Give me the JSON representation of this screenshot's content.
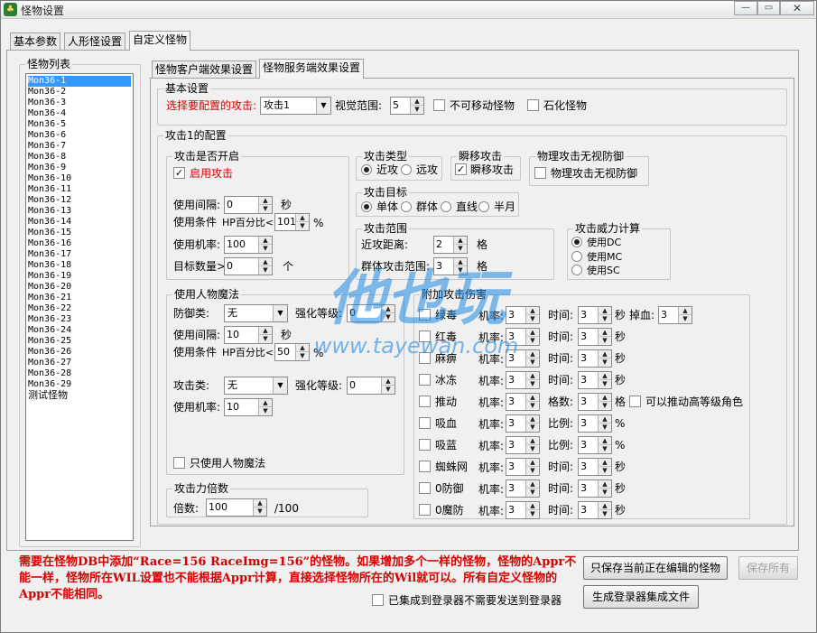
{
  "window": {
    "title": "怪物设置"
  },
  "main_tabs": [
    "基本参数",
    "人形怪设置",
    "自定义怪物"
  ],
  "monster_list": {
    "title": "怪物列表",
    "items": [
      "Mon36-1",
      "Mon36-2",
      "Mon36-3",
      "Mon36-4",
      "Mon36-5",
      "Mon36-6",
      "Mon36-7",
      "Mon36-8",
      "Mon36-9",
      "Mon36-10",
      "Mon36-11",
      "Mon36-12",
      "Mon36-13",
      "Mon36-14",
      "Mon36-15",
      "Mon36-16",
      "Mon36-17",
      "Mon36-18",
      "Mon36-19",
      "Mon36-20",
      "Mon36-21",
      "Mon36-22",
      "Mon36-23",
      "Mon36-24",
      "Mon36-25",
      "Mon36-26",
      "Mon36-27",
      "Mon36-28",
      "Mon36-29",
      "测试怪物"
    ]
  },
  "sub_tabs": [
    "怪物客户端效果设置",
    "怪物服务端效果设置"
  ],
  "basic": {
    "title": "基本设置",
    "select_attack_label": "选择要配置的攻击:",
    "attack_value": "攻击1",
    "view_range_label": "视觉范围:",
    "view_range_value": "5",
    "immovable_label": "不可移动怪物",
    "petrify_label": "石化怪物"
  },
  "config": {
    "title": "攻击1的配置",
    "enable_group": {
      "title": "攻击是否开启",
      "enable_label": "启用攻击",
      "interval_label": "使用间隔:",
      "interval_value": "0",
      "interval_unit": "秒",
      "cond_label": "使用条件",
      "hp_label": "HP百分比<",
      "hp_value": "101",
      "hp_unit": "%",
      "rate_label": "使用机率:",
      "rate_value": "100",
      "target_label": "目标数量>",
      "target_value": "0",
      "target_unit": "个"
    },
    "attack_type": {
      "title": "攻击类型",
      "opt1": "近攻",
      "opt2": "远攻"
    },
    "teleport": {
      "title": "瞬移攻击",
      "label": "瞬移攻击"
    },
    "phys_ignore": {
      "title": "物理攻击无视防御",
      "label": "物理攻击无视防御"
    },
    "target": {
      "title": "攻击目标",
      "opt1": "单体",
      "opt2": "群体",
      "opt3": "直线",
      "opt4": "半月"
    },
    "range": {
      "title": "攻击范围",
      "melee_label": "近攻距离:",
      "melee_value": "2",
      "group_label": "群体攻击范围:",
      "group_value": "3",
      "unit": "格"
    },
    "power": {
      "title": "攻击威力计算",
      "opt1": "使用DC",
      "opt2": "使用MC",
      "opt3": "使用SC"
    },
    "human_magic": {
      "title": "使用人物魔法",
      "defense_label": "防御类:",
      "defense_value": "无",
      "enhance_label": "强化等级:",
      "enhance_value": "0",
      "interval_label": "使用间隔:",
      "interval_value": "10",
      "interval_unit": "秒",
      "cond_label": "使用条件",
      "hp_label": "HP百分比<",
      "hp_value": "50",
      "hp_unit": "%",
      "attack_label": "攻击类:",
      "attack_value": "无",
      "enhance2_label": "强化等级:",
      "enhance2_value": "0",
      "rate_label": "使用机率:",
      "rate_value": "10",
      "only_label": "只使用人物魔法"
    },
    "multiplier": {
      "title": "攻击力倍数",
      "label": "倍数:",
      "value": "100",
      "unit": "/100"
    },
    "extra": {
      "title": "附加攻击伤害",
      "rate_label": "机率:",
      "rows": [
        {
          "name": "绿毒",
          "rate": "3",
          "p_label": "时间:",
          "p_value": "3",
          "p_unit": "秒",
          "extra_label": "掉血:",
          "extra_value": "3"
        },
        {
          "name": "红毒",
          "rate": "3",
          "p_label": "时间:",
          "p_value": "3",
          "p_unit": "秒"
        },
        {
          "name": "麻痹",
          "rate": "3",
          "p_label": "时间:",
          "p_value": "3",
          "p_unit": "秒"
        },
        {
          "name": "冰冻",
          "rate": "3",
          "p_label": "时间:",
          "p_value": "3",
          "p_unit": "秒"
        },
        {
          "name": "推动",
          "rate": "3",
          "p_label": "格数:",
          "p_value": "3",
          "p_unit": "格",
          "check_label": "可以推动高等级角色"
        },
        {
          "name": "吸血",
          "rate": "3",
          "p_label": "比例:",
          "p_value": "3",
          "p_unit": "%"
        },
        {
          "name": "吸蓝",
          "rate": "3",
          "p_label": "比例:",
          "p_value": "3",
          "p_unit": "%"
        },
        {
          "name": "蜘蛛网",
          "rate": "3",
          "p_label": "时间:",
          "p_value": "3",
          "p_unit": "秒"
        },
        {
          "name": "0防御",
          "rate": "3",
          "p_label": "时间:",
          "p_value": "3",
          "p_unit": "秒"
        },
        {
          "name": "0魔防",
          "rate": "3",
          "p_label": "时间:",
          "p_value": "3",
          "p_unit": "秒"
        }
      ]
    }
  },
  "note": "需要在怪物DB中添加“Race=156 RaceImg=156”的怪物。如果增加多个一样的怪物，怪物的Appr不能一样，怪物所在WIL设置也不能根据Appr计算，直接选择怪物所在的Wil就可以。所有自定义怪物的Appr不能相同。",
  "buttons": {
    "save_current": "只保存当前正在编辑的怪物",
    "save_all": "保存所有",
    "gen_login": "生成登录器集成文件"
  },
  "integrated_label": "已集成到登录器不需要发送到登录器",
  "watermark": {
    "big": "他也玩",
    "url": "www.tayewan.com"
  }
}
